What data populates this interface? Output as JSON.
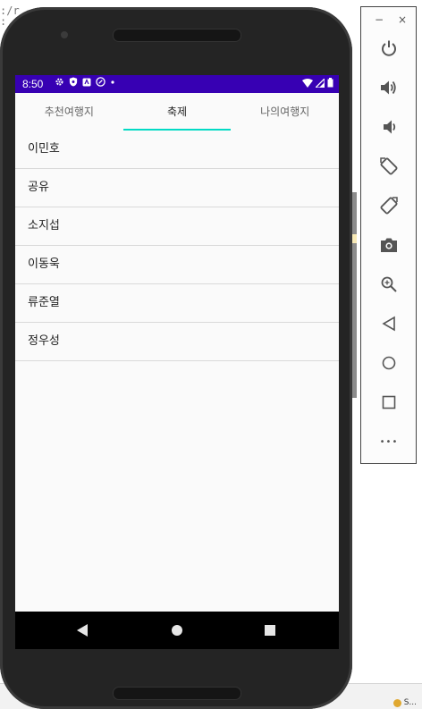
{
  "background": {
    "code_fragment": ":/r\n:",
    "status_text": "S..."
  },
  "status_bar": {
    "time": "8:50",
    "bg_color": "#3700b3"
  },
  "tabs": [
    {
      "label": "추천여행지",
      "active": false
    },
    {
      "label": "축제",
      "active": true
    },
    {
      "label": "나의여행지",
      "active": false
    }
  ],
  "list_items": [
    "이민호",
    "공유",
    "소지섭",
    "이동욱",
    "류준열",
    "정우성"
  ],
  "accent_color": "#03dac5",
  "emulator_panel": {
    "minimize_label": "−",
    "close_label": "×",
    "more_label": "•••",
    "buttons": [
      "power-icon",
      "volume-up-icon",
      "volume-down-icon",
      "rotate-left-icon",
      "rotate-right-icon",
      "camera-icon",
      "zoom-icon",
      "back-icon",
      "home-icon",
      "overview-icon",
      "more-icon"
    ]
  }
}
